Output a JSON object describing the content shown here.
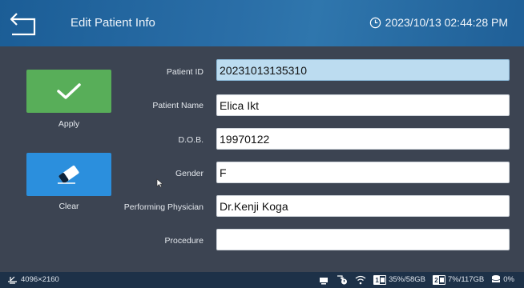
{
  "header": {
    "title": "Edit Patient Info",
    "datetime": "2023/10/13 02:44:28 PM",
    "accent": "#1f5f97"
  },
  "actions": {
    "apply_label": "Apply",
    "clear_label": "Clear",
    "apply_color": "#58ae59",
    "clear_color": "#2b8fdd"
  },
  "form": {
    "fields": [
      {
        "label": "Patient ID",
        "value": "20231013135310"
      },
      {
        "label": "Patient Name",
        "value": "Elica Ikt"
      },
      {
        "label": "D.O.B.",
        "value": "19970122"
      },
      {
        "label": "Gender",
        "value": "F"
      },
      {
        "label": "Performing Physician",
        "value": "Dr.Kenji Koga"
      },
      {
        "label": "Procedure",
        "value": ""
      }
    ]
  },
  "statusbar": {
    "resolution": "4096×2160",
    "disk1_num": "1",
    "disk1_text": "35%/58GB",
    "disk2_num": "2",
    "disk2_text": "7%/117GB",
    "storage_text": "0%"
  },
  "icons": [
    "back-icon",
    "clock-icon",
    "check-icon",
    "eraser-icon",
    "display-icon",
    "device-icon",
    "sync-icon",
    "wifi-icon",
    "disk-icon",
    "storage-icon"
  ]
}
